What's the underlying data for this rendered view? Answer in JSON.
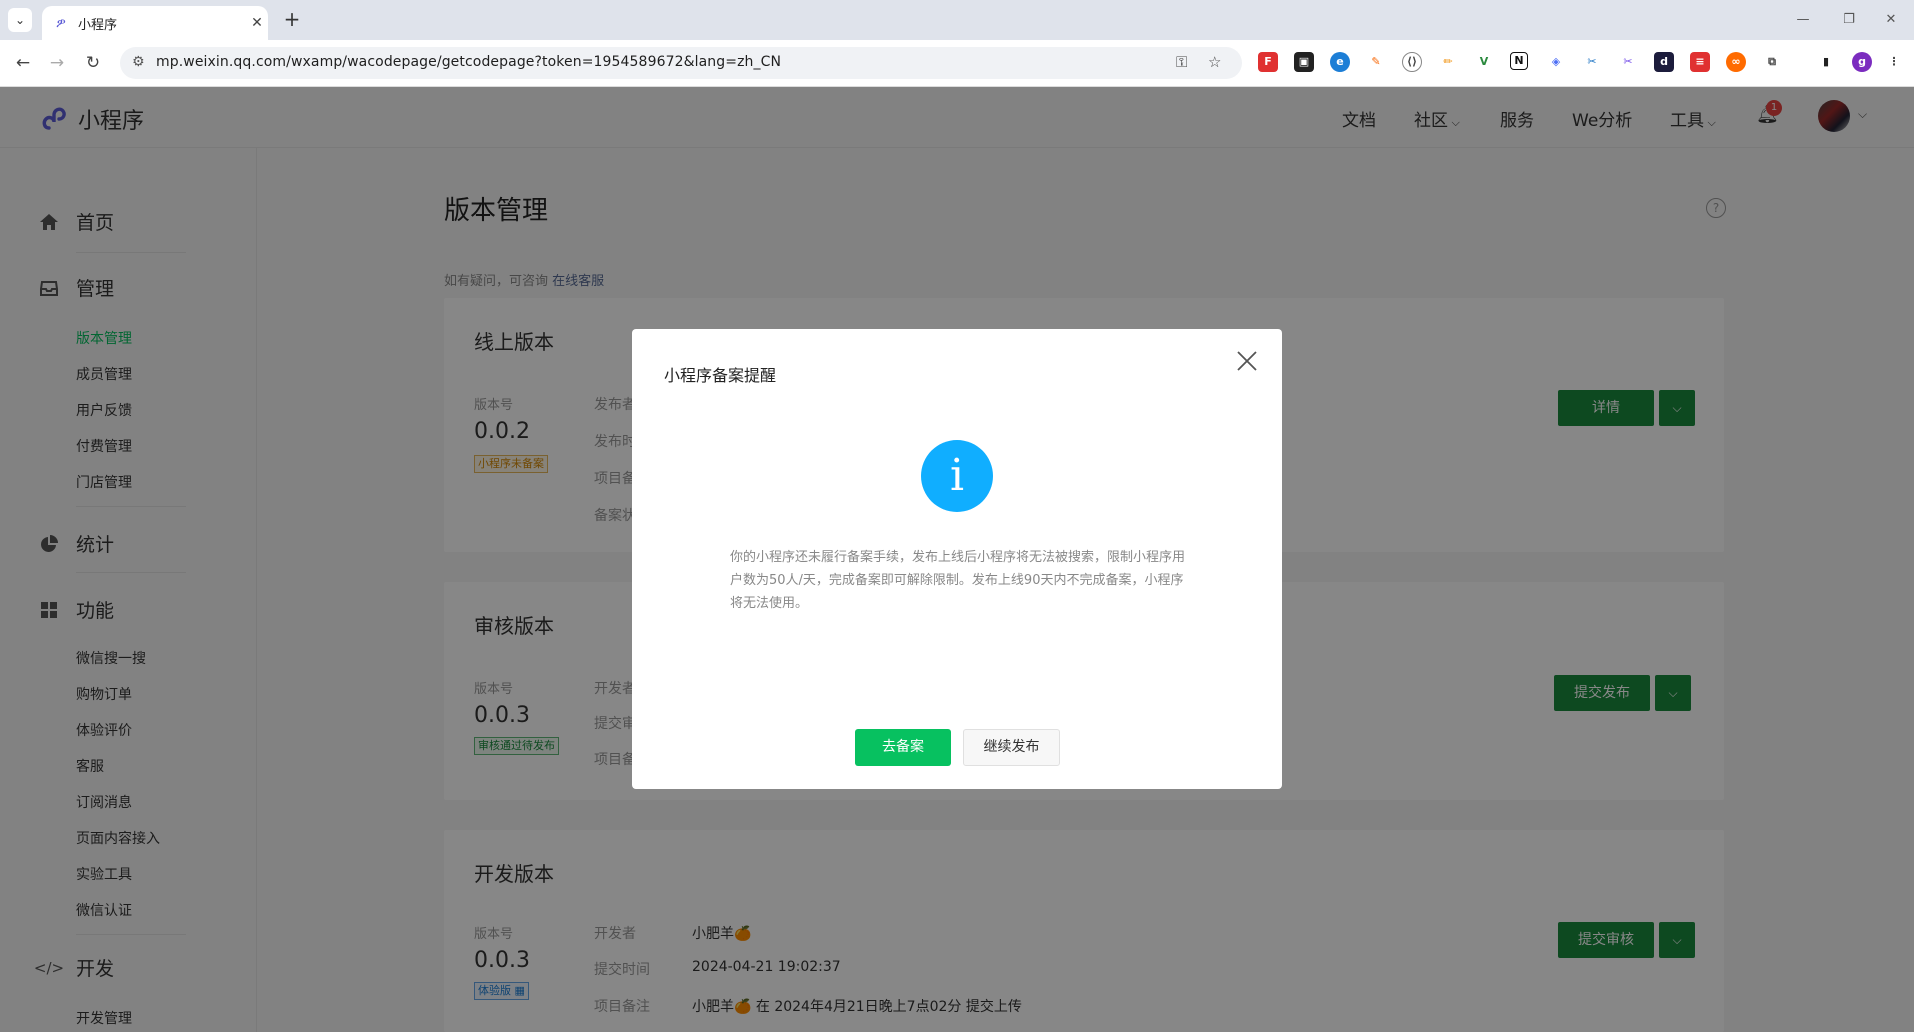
{
  "browser": {
    "tab_title": "小程序",
    "url": "mp.weixin.qq.com/wxamp/wacodepage/getcodepage?token=1954589672&lang=zh_CN",
    "profile_initial": "g"
  },
  "header": {
    "logo_text": "小程序",
    "nav": [
      "文档",
      "社区",
      "服务",
      "We分析",
      "工具"
    ],
    "notification_count": "1"
  },
  "sidebar": {
    "groups": {
      "home": "首页",
      "manage": "管理",
      "stats": "统计",
      "features": "功能",
      "dev": "开发"
    },
    "manage_items": [
      "版本管理",
      "成员管理",
      "用户反馈",
      "付费管理",
      "门店管理"
    ],
    "feature_items": [
      "微信搜一搜",
      "购物订单",
      "体验评价",
      "客服",
      "订阅消息",
      "页面内容接入",
      "实验工具",
      "微信认证"
    ],
    "dev_items": [
      "开发管理"
    ]
  },
  "main": {
    "title": "版本管理",
    "tip_text": "如有疑问，可咨询",
    "tip_link": "在线客服",
    "online": {
      "heading": "线上版本",
      "version_label": "版本号",
      "version": "0.0.2",
      "tag": "小程序未备案",
      "fields": [
        "发布者",
        "发布时",
        "项目备",
        "备案状"
      ],
      "button": "详情"
    },
    "review": {
      "heading": "审核版本",
      "version_label": "版本号",
      "version": "0.0.3",
      "tag": "审核通过待发布",
      "fields": [
        "开发者",
        "提交审",
        "项目备"
      ],
      "button": "提交发布"
    },
    "develop": {
      "heading": "开发版本",
      "version_label": "版本号",
      "version": "0.0.3",
      "tag": "体验版",
      "fields": [
        "开发者",
        "提交时间",
        "项目备注"
      ],
      "values": [
        "小肥羊🍊",
        "2024-04-21 19:02:37",
        "小肥羊🍊 在 2024年4月21日晚上7点02分 提交上传"
      ],
      "button": "提交审核"
    }
  },
  "dialog": {
    "title": "小程序备案提醒",
    "message": "你的小程序还未履行备案手续，发布上线后小程序将无法被搜索，限制小程序用户数为50人/天，完成备案即可解除限制。发布上线90天内不完成备案，小程序将无法使用。",
    "primary_button": "去备案",
    "secondary_button": "继续发布"
  },
  "colors": {
    "brand_green": "#07c160",
    "dark_green_button": "#1a8a3e",
    "info_blue": "#10aeff",
    "badge_red": "#e64340"
  }
}
